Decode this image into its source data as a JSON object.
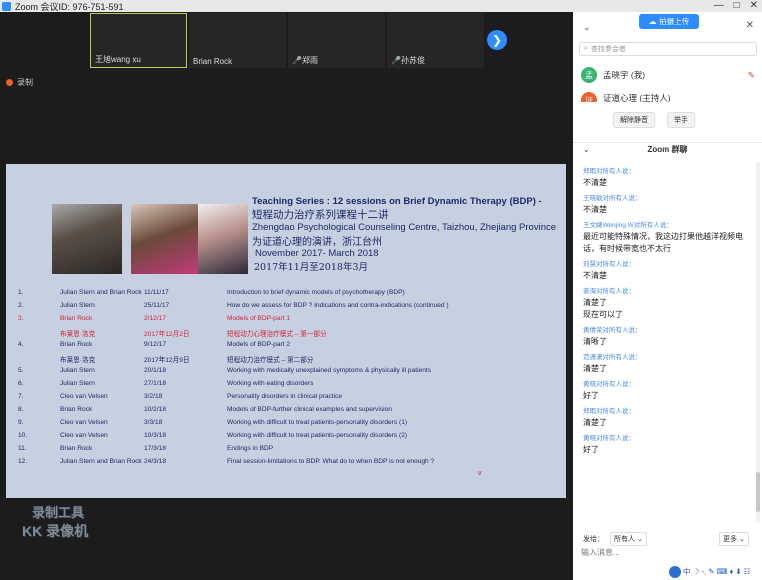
{
  "window": {
    "title": "Zoom 会议ID: 976-751-591",
    "controls": [
      "—",
      "□",
      "✕"
    ]
  },
  "thumbnails": [
    {
      "name": "王旭wang xu",
      "active": true,
      "muted": false
    },
    {
      "name": "Brian Rock",
      "active": false,
      "muted": false
    },
    {
      "name": "郑雨",
      "active": false,
      "muted": true
    },
    {
      "name": "孙苏俊",
      "active": false,
      "muted": true
    }
  ],
  "recording_label": "录制",
  "slide": {
    "title_en": "Teaching Series : 12 sessions on Brief Dynamic Therapy (BDP) -",
    "title_cn": "短程动力治疗系列课程十二讲",
    "org_en": "Zhengdao Psychological Counseling Centre, Taizhou, Zhejiang Province",
    "org_cn": "为证道心理的演讲，浙江台州",
    "period_en": "November 2017- March 2018",
    "period_cn": "2017年11月至2018年3月",
    "rows": [
      {
        "num": "1.",
        "who": "Julian Stern and Brian Rock",
        "date": "11/11/17",
        "topic": "Introduction to brief dynamic models of psychotherapy (BDP)",
        "red": false
      },
      {
        "num": "2.",
        "who": "Julian Stern",
        "date": "25/11/17",
        "topic": "How do we assess for BDP ? Indications and contra-indications (continued )",
        "red": false
      },
      {
        "num": "3.",
        "who": "Brian Rock",
        "date": "2/12/17",
        "topic": "Models of BDP-part 1",
        "red": true
      },
      {
        "num": "",
        "who": "布莱恩·洛克",
        "date": "2017年12月2日",
        "topic": "短程动力心理治疗模式 – 第一部分",
        "red": true
      },
      {
        "num": "4.",
        "who": "Brian Rock",
        "date": "9/12/17",
        "topic": "Models of BDP-part 2",
        "red": false
      },
      {
        "num": "",
        "who": "布莱恩·洛克",
        "date": "2017年12月9日",
        "topic": "短程动力治疗模式 – 第二部分",
        "red": false
      },
      {
        "num": "5.",
        "who": "Julian Stern",
        "date": "20/1/18",
        "topic": "Working with medically unexplained symptoms & physically ill patients",
        "red": false
      },
      {
        "num": "6.",
        "who": "Julian Stern",
        "date": "27/1/18",
        "topic": "Working with eating disorders",
        "red": false
      },
      {
        "num": "7.",
        "who": "Cleo van Velsen",
        "date": "3/2/18",
        "topic": "Personality disorders in clinical practice",
        "red": false
      },
      {
        "num": "8.",
        "who": "Brian Rock",
        "date": "10/2/18",
        "topic": "Models of BDP-further clinical examples and supervision",
        "red": false
      },
      {
        "num": "9.",
        "who": "Cleo van Velsen",
        "date": "3/3/18",
        "topic": "Working with difficult to treat patients-personality disorders (1)",
        "red": false
      },
      {
        "num": "10.",
        "who": "Cleo van Velsen",
        "date": "10/3/18",
        "topic": "Working with difficult to treat patients-personality disorders (2)",
        "red": false
      },
      {
        "num": "11.",
        "who": "Brian Rock",
        "date": "17/3/18",
        "topic": "Endings in BDP",
        "red": false
      },
      {
        "num": "12.",
        "who": "Julian Stern and Brian Rock",
        "date": "24/3/18",
        "topic": "Final session-limitations to BDP. What do to when BDP is not enough ?",
        "red": false
      }
    ],
    "marker": "v"
  },
  "watermark": {
    "line1": "录制工具",
    "line2": "KK 录像机"
  },
  "sidebar": {
    "upload_label": "拍摄上传",
    "search_placeholder": "查找参会者",
    "participants": [
      {
        "initial": "孟",
        "name": "孟晓宇 (我)",
        "color": "#3cb371"
      },
      {
        "initial": "证",
        "name": "证道心理 (主持人)",
        "color": "#e8622d"
      }
    ],
    "unmute_all": "解除静音",
    "raise_hand": "举手",
    "chat_title": "Zoom 群聊",
    "messages": [
      {
        "sender": "郑雨对所有人说：",
        "text": "不清楚"
      },
      {
        "sender": "王晓敏对所有人说：",
        "text": "不清楚"
      },
      {
        "sender": "王文婕Wenjing.W对所有人说：",
        "text": "最近可能特殊情况，我这边打果他越洋视频电话，有时候带宽也不太行"
      },
      {
        "sender": "刘慧对所有人说：",
        "text": "不清楚"
      },
      {
        "sender": "姜海对所有人说：",
        "text": "清楚了\n现在可以了"
      },
      {
        "sender": "黄倩荣对所有人说：",
        "text": "清晰了"
      },
      {
        "sender": "范潇潇对所有人说：",
        "text": "清楚了"
      },
      {
        "sender": "黄晓对所有人说：",
        "text": "好了"
      },
      {
        "sender": "郑雨对所有人说：",
        "text": "清楚了"
      },
      {
        "sender": "黄晓对所有人说：",
        "text": "好了"
      }
    ],
    "send_to_label": "发给：",
    "send_to_value": "所有人",
    "more_label": "更多",
    "input_placeholder": "输入消息...",
    "ime_text": "中 ☽ ◦, ✎ ⌨ ♦ ⬇ ☷"
  }
}
